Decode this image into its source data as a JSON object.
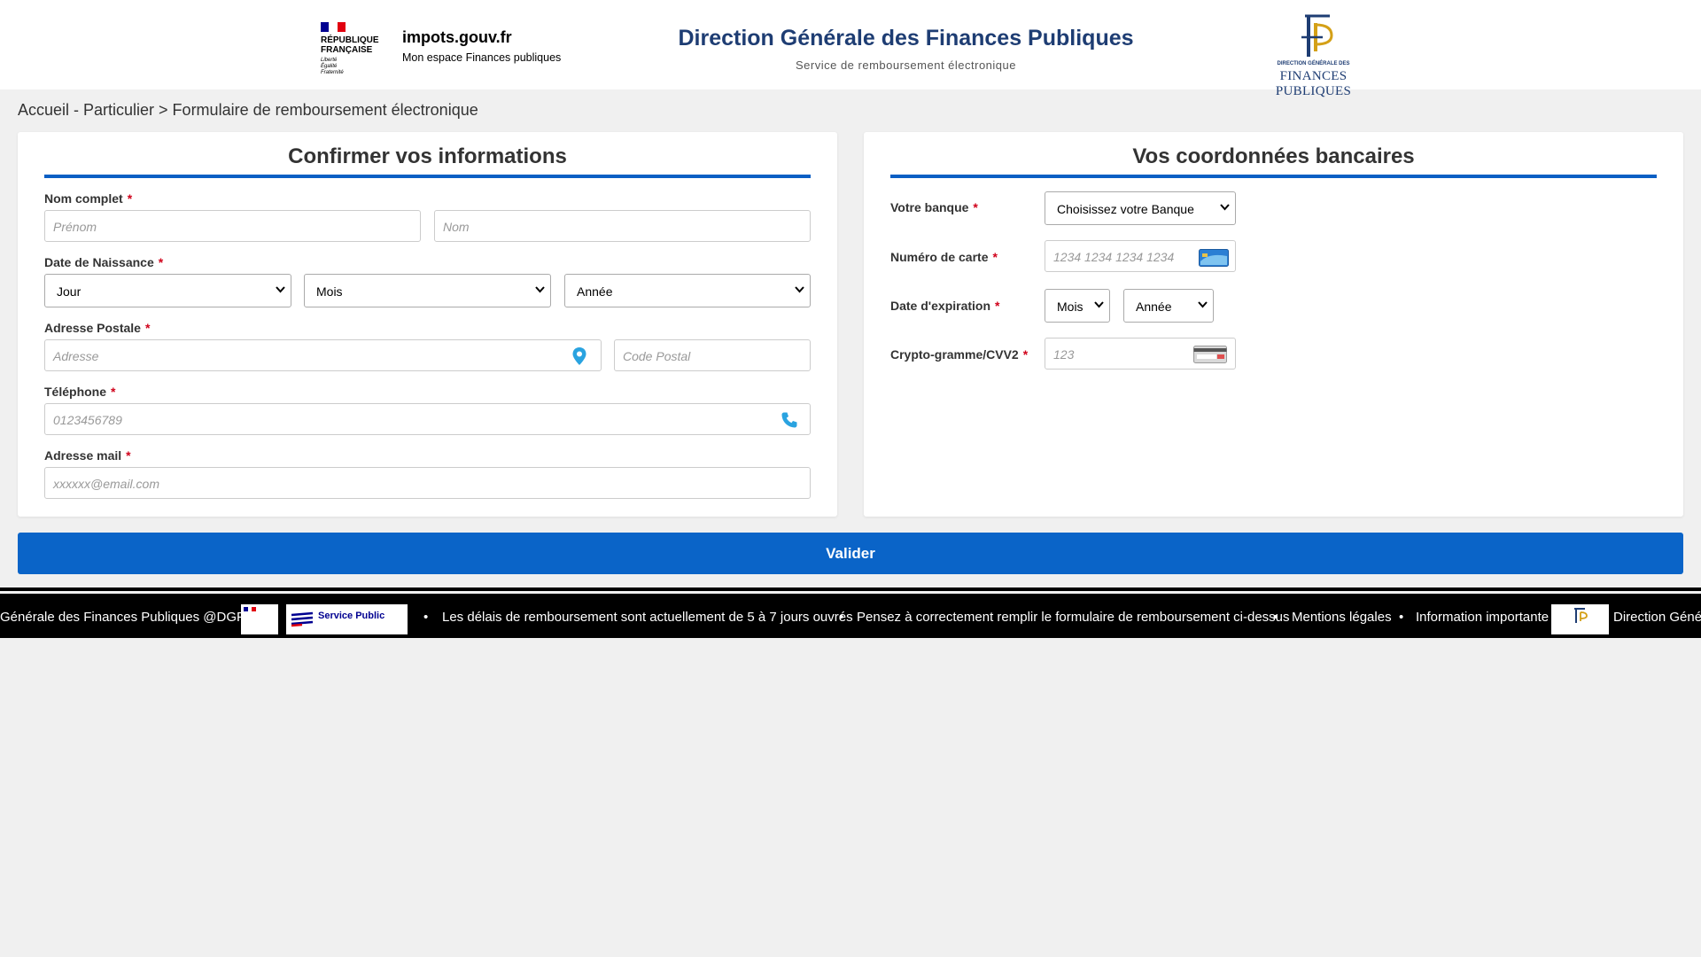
{
  "header": {
    "rf_title": "RÉPUBLIQUE\nFRANÇAISE",
    "rf_motto": "Liberté\nÉgalité\nFraternité",
    "rf_flag_colors": [
      "#000091",
      "#ffffff",
      "#e1000f"
    ],
    "impots_domain": "impots.gouv.fr",
    "impots_sub": "Mon espace Finances publiques",
    "title": "Direction Générale des Finances Publiques",
    "subtitle": "Service de remboursement électronique",
    "dgfip_small": "DIRECTION GÉNÉRALE DES",
    "dgfip_big": "FINANCES PUBLIQUES",
    "title_color": "#1e3d73"
  },
  "breadcrumb": "Accueil - Particulier > Formulaire de remboursement électronique",
  "left_panel": {
    "title": "Confirmer vos informations",
    "full_name": {
      "label": "Nom complet",
      "first_placeholder": "Prénom",
      "last_placeholder": "Nom"
    },
    "birth_date": {
      "label": "Date de Naissance",
      "day": "Jour",
      "month": "Mois",
      "year": "Année"
    },
    "address": {
      "label": "Adresse Postale",
      "placeholder": "Adresse",
      "postal_placeholder": "Code Postal"
    },
    "phone": {
      "label": "Téléphone",
      "placeholder": "0123456789"
    },
    "email": {
      "label": "Adresse mail",
      "placeholder": "xxxxxx@email.com"
    }
  },
  "right_panel": {
    "title": "Vos coordonnées bancaires",
    "bank": {
      "label": "Votre banque",
      "value": "Choisissez votre Banque"
    },
    "card_number": {
      "label": "Numéro de carte",
      "placeholder": "1234 1234 1234 1234"
    },
    "expiration": {
      "label": "Date d'expiration",
      "month": "Mois",
      "year": "Année"
    },
    "cvv": {
      "label": "Crypto-gramme/CVV2",
      "placeholder": "123"
    }
  },
  "required_mark": "*",
  "submit_label": "Valider",
  "accent_color": "#0a64c8",
  "ticker": {
    "lead_text": "Générale des Finances Publiques @DGFiP",
    "separator": "•",
    "delay_text": "Les délais de remboursement sont actuellement de 5 à 7 jours ouvrés",
    "reminder_text": "Pensez à correctement remplir le formulaire de remboursement ci-dessus",
    "legal_text": "Mentions légales",
    "info_text": "Information importante :",
    "trail_text": "Direction Générale",
    "service_public_label": "Service Public"
  }
}
